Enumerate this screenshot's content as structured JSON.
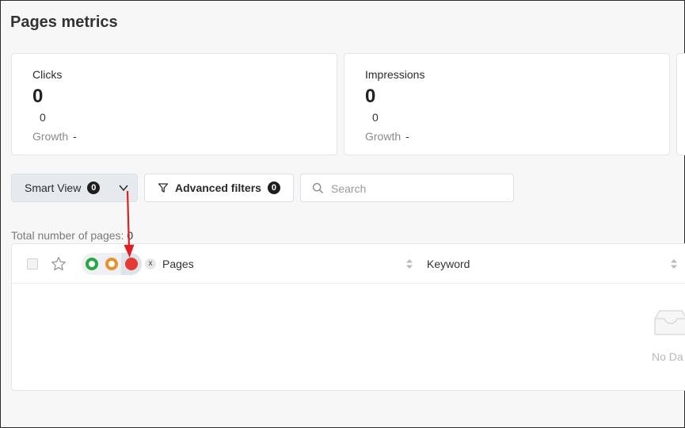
{
  "page": {
    "title": "Pages metrics"
  },
  "metrics": [
    {
      "label": "Clicks",
      "value": "0",
      "sub_value": "0",
      "growth_label": "Growth",
      "growth_value": "-"
    },
    {
      "label": "Impressions",
      "value": "0",
      "sub_value": "0",
      "growth_label": "Growth",
      "growth_value": "-"
    }
  ],
  "toolbar": {
    "smart_view_label": "Smart View",
    "smart_view_count": "0",
    "advanced_filters_label": "Advanced filters",
    "advanced_filters_count": "0",
    "search_placeholder": "Search",
    "search_value": ""
  },
  "summary": {
    "total_label": "Total number of pages:",
    "total_value": "0"
  },
  "table": {
    "status_filters": [
      {
        "name": "green",
        "color": "#28a745"
      },
      {
        "name": "orange",
        "color": "#e8912d"
      },
      {
        "name": "red",
        "color": "#e53935",
        "selected": true
      }
    ],
    "clear_label": "x",
    "columns": [
      {
        "label": "Pages",
        "sortable": true
      },
      {
        "label": "Keyword",
        "sortable": true
      }
    ],
    "empty_text": "No Da"
  },
  "colors": {
    "annotation_arrow": "#e02020",
    "badge_bg": "#1e1e1e"
  }
}
